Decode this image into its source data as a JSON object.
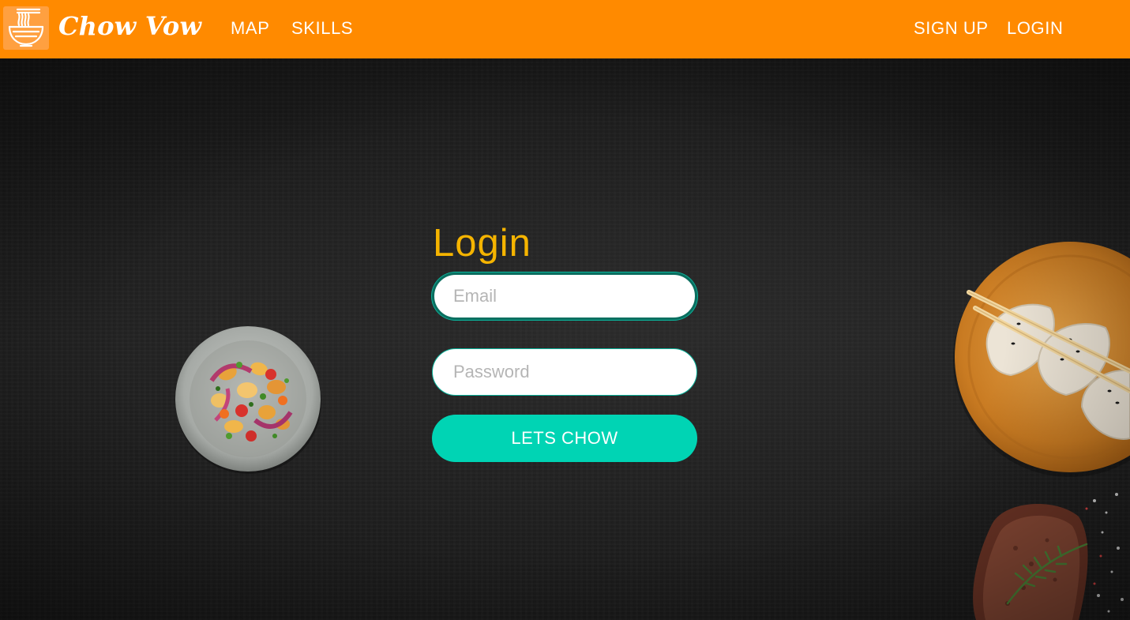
{
  "navbar": {
    "brand_name": "Chow Vow",
    "logo_icon": "noodle-bowl-icon",
    "left_links": [
      "MAP",
      "SKILLS"
    ],
    "right_links": [
      "SIGN UP",
      "LOGIN"
    ],
    "background_color": "#ff8a00"
  },
  "login": {
    "title": "Login",
    "email_placeholder": "Email",
    "email_value": "",
    "password_placeholder": "Password",
    "password_value": "",
    "submit_label": "LETS CHOW",
    "title_color": "#f5b400",
    "button_color": "#00d4b4"
  },
  "images": {
    "left": "salad-bowl-image",
    "right_top": "dumplings-plate-image",
    "right_bottom": "steak-image"
  }
}
